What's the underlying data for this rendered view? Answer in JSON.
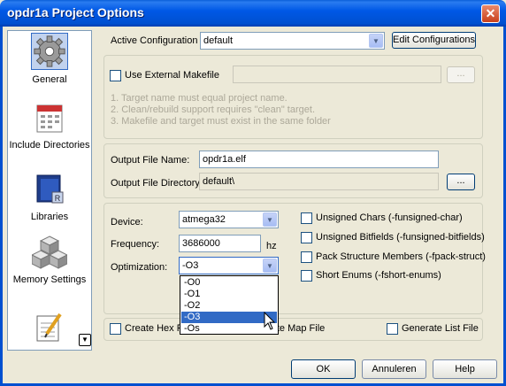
{
  "window": {
    "title": "opdr1a Project Options"
  },
  "sidebar": {
    "items": [
      {
        "label": "General",
        "icon": "gear-icon"
      },
      {
        "label": "Include Directories",
        "icon": "calendar-icon"
      },
      {
        "label": "Libraries",
        "icon": "books-icon"
      },
      {
        "label": "Memory Settings",
        "icon": "cubes-icon"
      },
      {
        "label": "",
        "icon": "notepad-icon"
      }
    ]
  },
  "active_config": {
    "label": "Active Configuration",
    "value": "default",
    "button": "Edit Configurations"
  },
  "makefile": {
    "checkbox_label": "Use External Makefile",
    "browse": "...",
    "notes": [
      "1. Target name must equal project name.",
      "2. Clean/rebuild support requires  \"clean\" target.",
      "3. Makefile and target must exist in the same folder"
    ]
  },
  "output": {
    "file_name_label": "Output File Name:",
    "file_name_value": "opdr1a.elf",
    "dir_label": "Output File Directory:",
    "dir_value": "default\\",
    "browse": "..."
  },
  "device": {
    "device_label": "Device:",
    "device_value": "atmega32",
    "freq_label": "Frequency:",
    "freq_value": "3686000",
    "freq_unit": "hz",
    "opt_label": "Optimization:",
    "opt_value": "-O3",
    "opt_options": [
      "-O0",
      "-O1",
      "-O2",
      "-O3",
      "-Os"
    ],
    "opt_selected_index": 3
  },
  "flags": [
    {
      "label": "Unsigned Chars (-funsigned-char)",
      "checked": false
    },
    {
      "label": "Unsigned Bitfields (-funsigned-bitfields)",
      "checked": false
    },
    {
      "label": "Pack Structure Members (-fpack-struct)",
      "checked": false
    },
    {
      "label": "Short Enums (-fshort-enums)",
      "checked": false
    }
  ],
  "files": {
    "hex": "Create Hex File",
    "map": "Create Map File",
    "list": "Generate List File"
  },
  "buttons": {
    "ok": "OK",
    "cancel": "Annuleren",
    "help": "Help"
  }
}
